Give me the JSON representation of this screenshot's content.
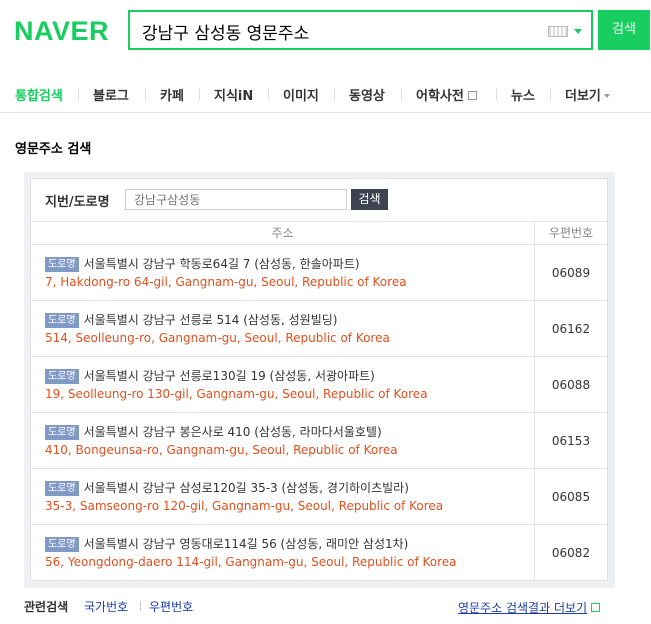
{
  "colors": {
    "brand": "#19ce60",
    "english_address": "#e0501f",
    "link": "#1a3da8",
    "badge": "#7f9ac4"
  },
  "header": {
    "logo": "NAVER",
    "search_query": "강남구 삼성동 영문주소",
    "search_button": "검색"
  },
  "nav": {
    "tabs": [
      {
        "label": "통합검색",
        "active": true
      },
      {
        "label": "블로그"
      },
      {
        "label": "카페"
      },
      {
        "label": "지식iN"
      },
      {
        "label": "이미지"
      },
      {
        "label": "동영상"
      },
      {
        "label": "어학사전"
      },
      {
        "label": "뉴스"
      },
      {
        "label": "더보기"
      }
    ]
  },
  "section_title": "영문주소 검색",
  "lookup": {
    "label": "지번/도로명",
    "placeholder": "강남구삼성동",
    "button": "검색"
  },
  "table": {
    "headers": {
      "address": "주소",
      "zipcode": "우편번호"
    },
    "rows": [
      {
        "badge": "도로명",
        "korean": "서울특별시 강남구 학동로64길 7 (삼성동, 한솔아파트)",
        "english": "7, Hakdong-ro 64-gil, Gangnam-gu, Seoul, Republic of Korea",
        "zipcode": "06089"
      },
      {
        "badge": "도로명",
        "korean": "서울특별시 강남구 선릉로 514 (삼성동, 성원빌딩)",
        "english": "514, Seolleung-ro, Gangnam-gu, Seoul, Republic of Korea",
        "zipcode": "06162"
      },
      {
        "badge": "도로명",
        "korean": "서울특별시 강남구 선릉로130길 19 (삼성동, 서광아파트)",
        "english": "19, Seolleung-ro 130-gil, Gangnam-gu, Seoul, Republic of Korea",
        "zipcode": "06088"
      },
      {
        "badge": "도로명",
        "korean": "서울특별시 강남구 봉은사로 410 (삼성동, 라마다서울호텔)",
        "english": "410, Bongeunsa-ro, Gangnam-gu, Seoul, Republic of Korea",
        "zipcode": "06153"
      },
      {
        "badge": "도로명",
        "korean": "서울특별시 강남구 삼성로120길 35-3 (삼성동, 경기하이츠빌라)",
        "english": "35-3, Samseong-ro 120-gil, Gangnam-gu, Seoul, Republic of Korea",
        "zipcode": "06085"
      },
      {
        "badge": "도로명",
        "korean": "서울특별시 강남구 영동대로114길 56 (삼성동, 래미안 삼성1차)",
        "english": "56, Yeongdong-daero 114-gil, Gangnam-gu, Seoul, Republic of Korea",
        "zipcode": "06082"
      }
    ]
  },
  "footer": {
    "related_label": "관련검색",
    "related_links": [
      "국가번호",
      "우편번호"
    ],
    "more_link": "영문주소 검색결과 더보기"
  }
}
